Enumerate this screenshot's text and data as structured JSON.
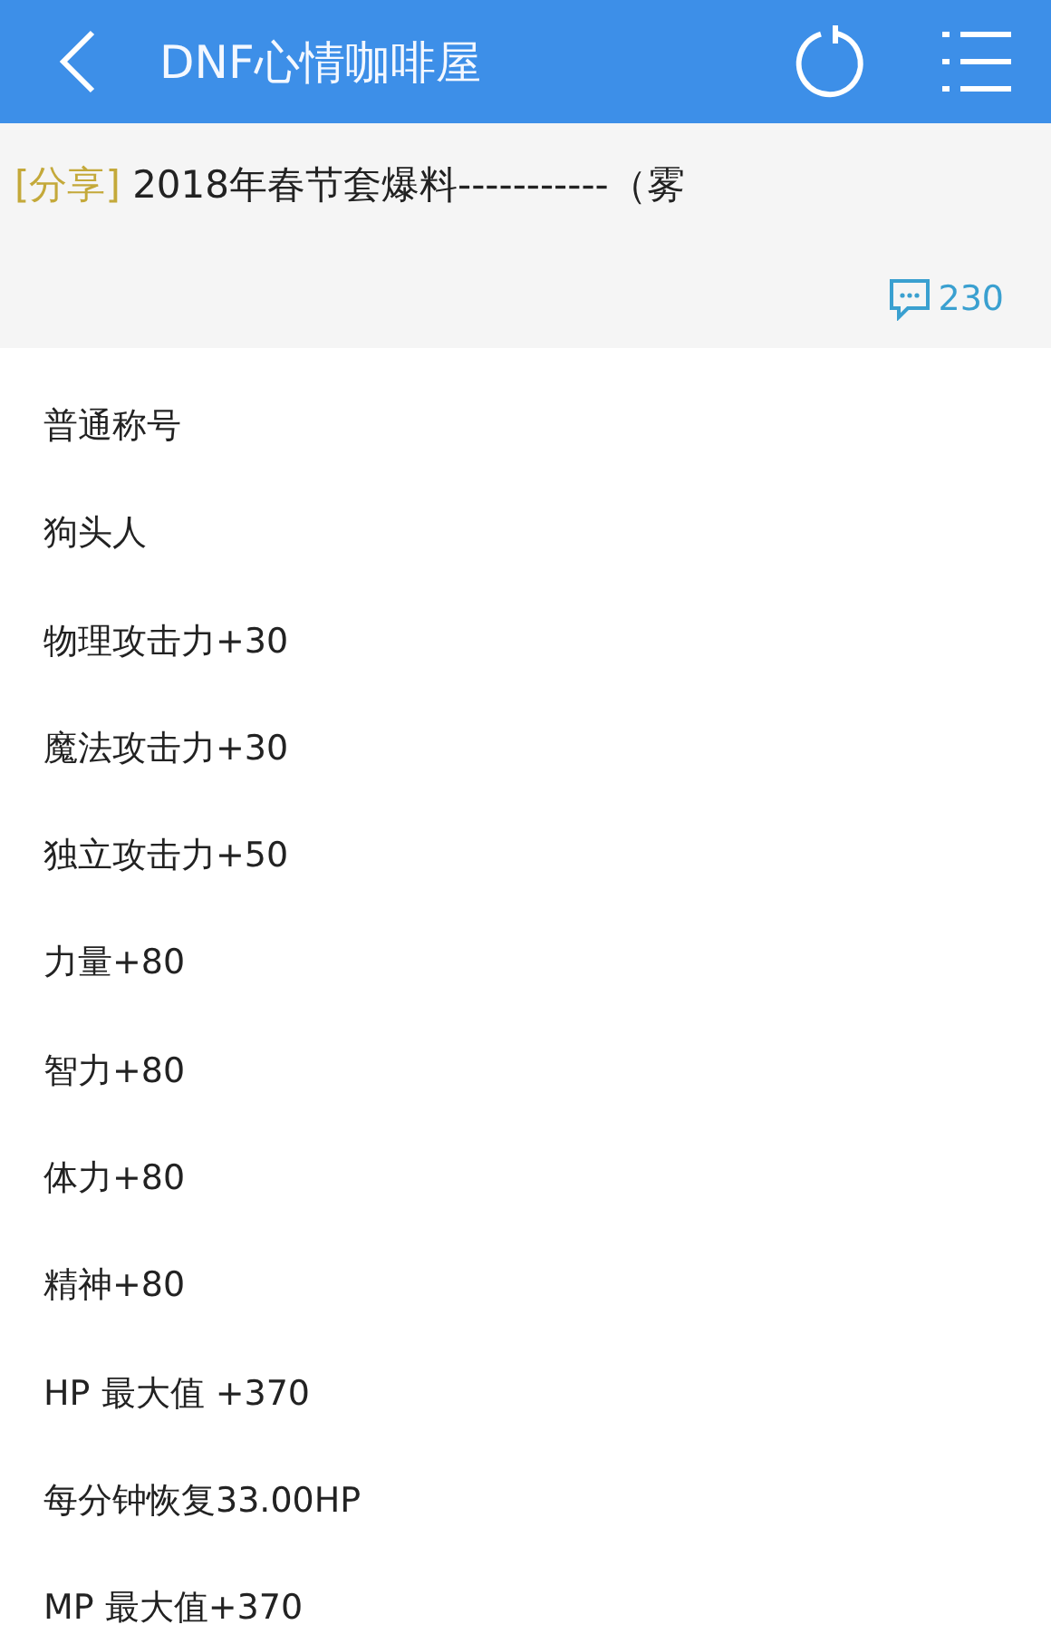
{
  "header": {
    "title": "DNF心情咖啡屋"
  },
  "post": {
    "tag": "[分享]",
    "title": "2018年春节套爆料-----------（雾",
    "comment_count": "230"
  },
  "lines": [
    "普通称号",
    "狗头人",
    "物理攻击力+30",
    "魔法攻击力+30",
    "独立攻击力+50",
    "力量+80",
    "智力+80",
    "体力+80",
    "精神+80",
    "HP 最大值 +370",
    "每分钟恢复33.00HP",
    "MP 最大值+370"
  ]
}
